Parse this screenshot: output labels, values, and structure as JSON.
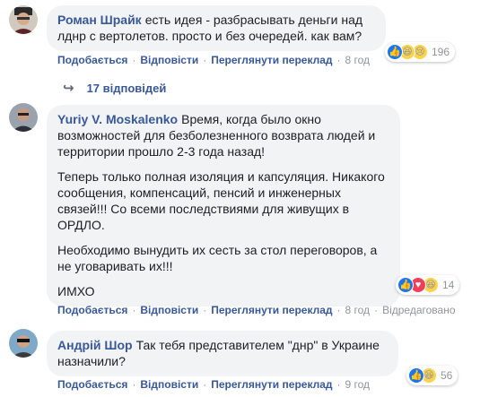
{
  "comments": [
    {
      "author": "Роман Шрайк",
      "text": "есть идея - разбрасывать деньги над лднр с вертолетов. просто и без очередей. как вам?",
      "reactions_count": "196",
      "actions": {
        "like": "Подобається",
        "reply": "Відповісти",
        "translate": "Переглянути переклад",
        "time": "8 год"
      }
    },
    {
      "author": "Yuriy V. Moskalenko",
      "paragraphs": [
        "Время, когда было окно возможностей для безболезненного возврата людей и территории прошло 2-3 года назад!",
        "Теперь только полная изоляция и капсуляция. Никакого сообщения, компенсаций, пенсий и инженерных связей!!! Со всеми последствиями для живущих в ОРДЛО.",
        "Необходимо вынудить их сесть за стол переговоров, а не уговаривать их!!!",
        "ИМХО"
      ],
      "reactions_count": "14",
      "actions": {
        "like": "Подобається",
        "reply": "Відповісти",
        "translate": "Переглянути переклад",
        "time": "8 год",
        "edited": "Відредаговано"
      }
    },
    {
      "author": "Андрій Шор",
      "text": "Так тебя представителем \"днр\" в Украине назначили?",
      "reactions_count": "56",
      "actions": {
        "like": "Подобається",
        "reply": "Відповісти",
        "translate": "Переглянути переклад",
        "time": "9 год"
      }
    }
  ],
  "replies_link": "17 відповідей",
  "colors": {
    "link": "#385898",
    "bubble": "#f2f3f5",
    "muted": "#90949c",
    "like": "#1877f2",
    "love": "#f33e58",
    "haha": "#fcd34d"
  },
  "icons": [
    "reply-arrow-icon",
    "like-reaction-icon",
    "love-reaction-icon",
    "haha-reaction-icon",
    "sad-reaction-icon"
  ]
}
